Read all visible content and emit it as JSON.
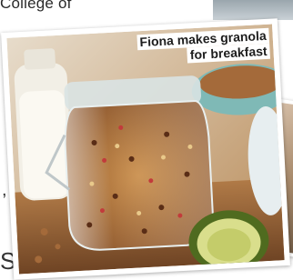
{
  "article": {
    "top_text": "College of",
    "margin_marks": [
      ",",
      "S"
    ]
  },
  "photo": {
    "caption_line1": "Fiona makes granola",
    "caption_line2": "for breakfast"
  }
}
